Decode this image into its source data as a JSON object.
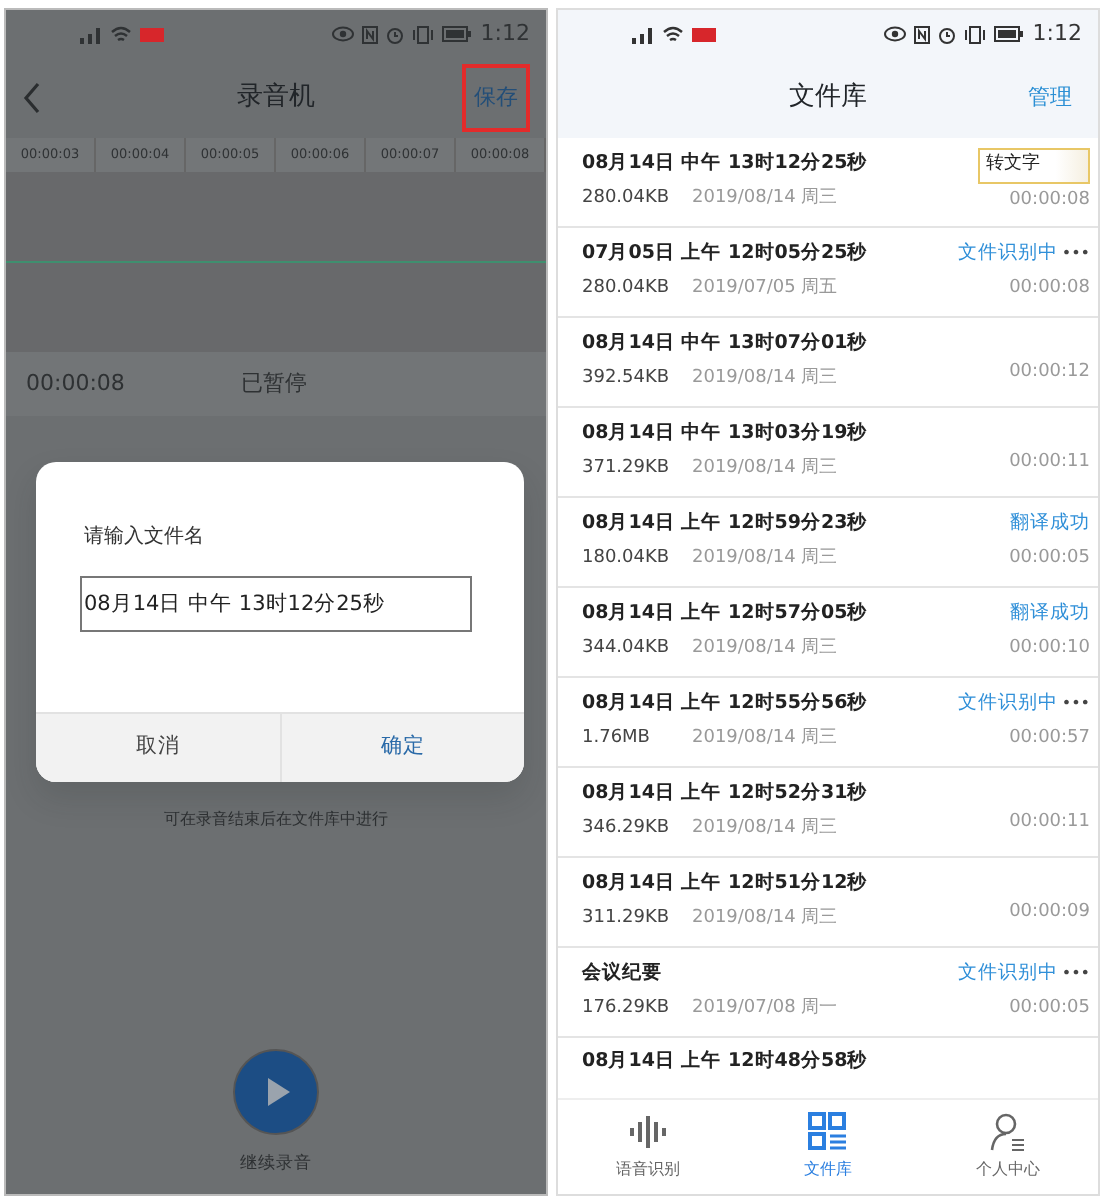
{
  "recorder": {
    "status_bar": {
      "time": "1:12"
    },
    "title": "录音机",
    "save": {
      "label": "保存",
      "highlighted": true
    },
    "timeline": [
      "00:00:03",
      "00:00:04",
      "00:00:05",
      "00:00:06",
      "00:00:07",
      "00:00:08"
    ],
    "elapsed": "00:00:08",
    "state": "已暂停",
    "hint": "可在录音结束后在文件库中进行",
    "resume": "继续录音"
  },
  "dialog": {
    "title": "请输入文件名",
    "value": "08月14日 中午 13时12分25秒",
    "buttons": [
      {
        "label": "取消",
        "primary": false
      },
      {
        "label": "确定",
        "primary": true
      }
    ]
  },
  "library": {
    "status_bar": {
      "time": "1:12"
    },
    "title": "文件库",
    "action": "管理",
    "files": [
      {
        "name": "08月14日 中午 13时12分25秒",
        "size": "280.04KB",
        "date": "2019/08/14 周三",
        "duration": "00:00:08",
        "status": {
          "kind": "button",
          "text": "转文字"
        }
      },
      {
        "name": "07月05日 上午 12时05分25秒",
        "size": "280.04KB",
        "date": "2019/07/05 周五",
        "duration": "00:00:08",
        "status": {
          "kind": "progress",
          "text": "文件识别中",
          "dots": "•••"
        }
      },
      {
        "name": "08月14日 中午 13时07分01秒",
        "size": "392.54KB",
        "date": "2019/08/14 周三",
        "duration": "00:00:12"
      },
      {
        "name": "08月14日 中午 13时03分19秒",
        "size": "371.29KB",
        "date": "2019/08/14 周三",
        "duration": "00:00:11"
      },
      {
        "name": "08月14日 上午 12时59分23秒",
        "size": "180.04KB",
        "date": "2019/08/14 周三",
        "duration": "00:00:05",
        "status": {
          "kind": "done",
          "text": "翻译成功"
        }
      },
      {
        "name": "08月14日 上午 12时57分05秒",
        "size": "344.04KB",
        "date": "2019/08/14 周三",
        "duration": "00:00:10",
        "status": {
          "kind": "done",
          "text": "翻译成功"
        }
      },
      {
        "name": "08月14日 上午 12时55分56秒",
        "size": "1.76MB",
        "date": "2019/08/14 周三",
        "duration": "00:00:57",
        "status": {
          "kind": "progress",
          "text": "文件识别中",
          "dots": "•••"
        }
      },
      {
        "name": "08月14日 上午 12时52分31秒",
        "size": "346.29KB",
        "date": "2019/08/14 周三",
        "duration": "00:00:11"
      },
      {
        "name": "08月14日 上午 12时51分12秒",
        "size": "311.29KB",
        "date": "2019/08/14 周三",
        "duration": "00:00:09"
      },
      {
        "name": "会议纪要",
        "size": "176.29KB",
        "date": "2019/07/08 周一",
        "duration": "00:00:05",
        "status": {
          "kind": "progress",
          "text": "文件识别中",
          "dots": "•••"
        }
      },
      {
        "name": "08月14日 上午 12时48分58秒"
      }
    ],
    "nav": [
      {
        "label": "语音识别",
        "kind": "wave",
        "selected": false
      },
      {
        "label": "文件库",
        "kind": "grid",
        "selected": true
      },
      {
        "label": "个人中心",
        "kind": "person",
        "selected": false
      }
    ]
  }
}
